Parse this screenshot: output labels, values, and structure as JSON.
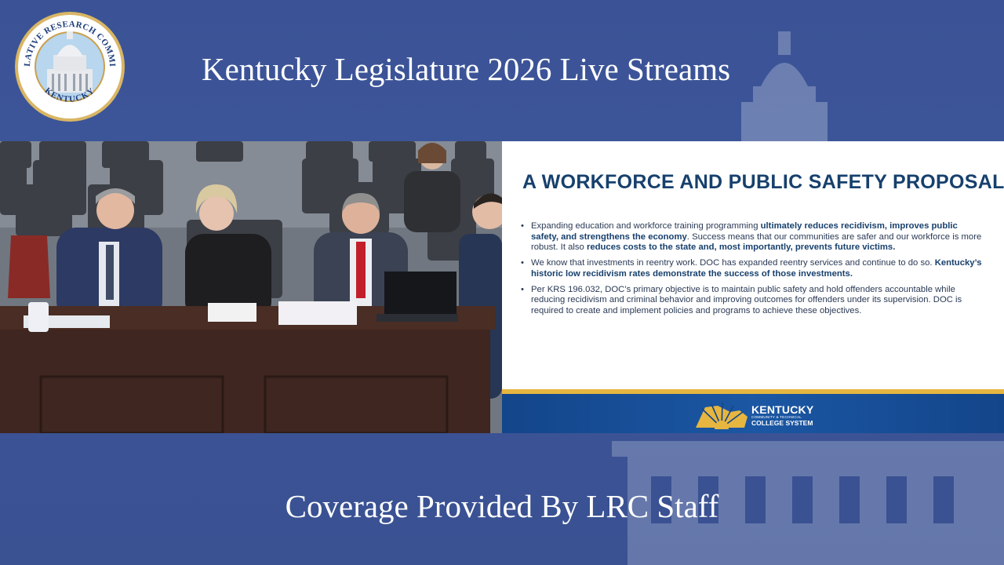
{
  "header": {
    "title": "Kentucky Legislature 2026 Live Streams",
    "seal": {
      "top_text": "LEGISLATIVE RESEARCH COMMISSION",
      "bottom_text": "KENTUCKY"
    }
  },
  "slide": {
    "title": "A WORKFORCE AND PUBLIC SAFETY PROPOSAL",
    "bullets": [
      [
        {
          "t": "Expanding education and workforce training programming ",
          "b": false
        },
        {
          "t": "ultimately reduces recidivism, improves public safety, and strengthens the economy",
          "b": true
        },
        {
          "t": ". Success means that our communities are safer and our workforce is more robust. It also ",
          "b": false
        },
        {
          "t": "reduces costs to the state and, most importantly, prevents future victims.",
          "b": true
        }
      ],
      [
        {
          "t": "We know that investments in reentry work. DOC has expanded reentry services and continue to do so. ",
          "b": false
        },
        {
          "t": "Kentucky’s historic low recidivism rates demonstrate the success of those investments.",
          "b": true
        }
      ],
      [
        {
          "t": "Per KRS 196.032, DOC’s primary objective is to maintain public safety and hold offenders accountable while reducing recidivism and criminal behavior and improving outcomes for offenders under its supervision. DOC is required to create and implement policies and programs to achieve these objectives.",
          "b": false
        }
      ]
    ],
    "logo": {
      "name": "KENTUCKY",
      "sub1": "COMMUNITY & TECHNICAL",
      "sub2": "COLLEGE SYSTEM",
      "icon": "sunburst-icon"
    }
  },
  "footer": {
    "text": "Coverage Provided By LRC Staff"
  },
  "colors": {
    "background": "#3a5192",
    "slide_title": "#17406d",
    "slide_band": "#1b57a3",
    "slide_gold": "#e6b640"
  }
}
